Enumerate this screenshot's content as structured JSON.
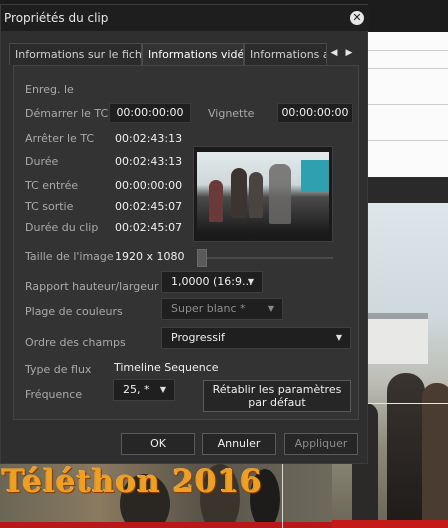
{
  "background": {
    "watermark_text": "Téléthon 2016"
  },
  "dialog": {
    "title": "Propriétés du clip",
    "tabs": [
      {
        "label": "Informations sur le fichier",
        "active": false
      },
      {
        "label": "Informations vidéo",
        "active": true
      },
      {
        "label": "Informations audio",
        "active": false
      }
    ],
    "fields": {
      "rec_label": "Enreg. le",
      "start_tc_label": "Démarrer le TC",
      "start_tc_value": "00:00:00:00",
      "thumbnail_label": "Vignette",
      "thumbnail_value": "00:00:00:00",
      "stop_tc_label": "Arrêter le TC",
      "stop_tc_value": "00:02:43:13",
      "duration_label": "Durée",
      "duration_value": "00:02:43:13",
      "tc_in_label": "TC entrée",
      "tc_in_value": "00:00:00:00",
      "tc_out_label": "TC sortie",
      "tc_out_value": "00:02:45:07",
      "clip_duration_label": "Durée du clip",
      "clip_duration_value": "00:02:45:07",
      "image_size_label": "Taille de l'image",
      "image_size_value": "1920 x 1080",
      "aspect_ratio_label": "Rapport hauteur/largeur",
      "aspect_ratio_value": "1,0000 (16:9...",
      "color_range_label": "Plage de couleurs",
      "color_range_value": "Super blanc *",
      "field_order_label": "Ordre des champs",
      "field_order_value": "Progressif",
      "stream_type_label": "Type de flux",
      "stream_type_value": "Timeline Sequence",
      "frequency_label": "Fréquence",
      "frequency_value": "25, *"
    },
    "slider_position": 0,
    "reset_button": "Rétablir les paramètres par défaut",
    "ok_button": "OK",
    "cancel_button": "Annuler",
    "apply_button": "Appliquer"
  }
}
